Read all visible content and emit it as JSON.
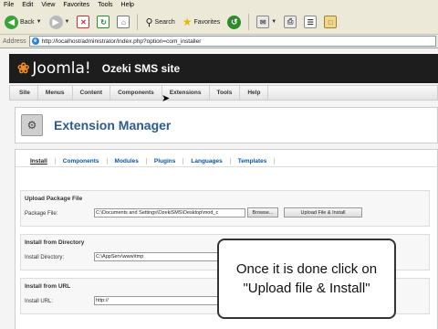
{
  "browser": {
    "menu": [
      "File",
      "Edit",
      "View",
      "Favorites",
      "Tools",
      "Help"
    ],
    "toolbar": {
      "back_label": "Back",
      "search_label": "Search",
      "favorites_label": "Favorites"
    },
    "address": {
      "label": "Address",
      "url": "http://localhost/administrator/index.php?option=com_installer"
    }
  },
  "header": {
    "logo": "Joomla!",
    "site_name": "Ozeki SMS site"
  },
  "top_menu": [
    "Site",
    "Menus",
    "Content",
    "Components",
    "Extensions",
    "Tools",
    "Help"
  ],
  "page_title": "Extension Manager",
  "sub_tabs": [
    "Install",
    "Components",
    "Modules",
    "Plugins",
    "Languages",
    "Templates"
  ],
  "sections": {
    "upload": {
      "title": "Upload Package File",
      "label": "Package File:",
      "value": "C:\\Documents and Settings\\OzekiSMS\\Desktop\\mod_c",
      "browse": "Browse...",
      "submit": "Upload File & Install"
    },
    "directory": {
      "title": "Install from Directory",
      "label": "Install Directory:",
      "value": "C:\\AppServ\\www\\tmp"
    },
    "url": {
      "title": "Install from URL",
      "label": "Install URL:",
      "value": "http://"
    }
  },
  "callout": {
    "line1": "Once it is done click on",
    "line2": "\"Upload file & Install\""
  },
  "colors": {
    "joomla_orange": "#f18a22",
    "header_bg": "#1d1d1d",
    "title_blue": "#2c5b8c",
    "link_blue": "#0b55a5"
  }
}
